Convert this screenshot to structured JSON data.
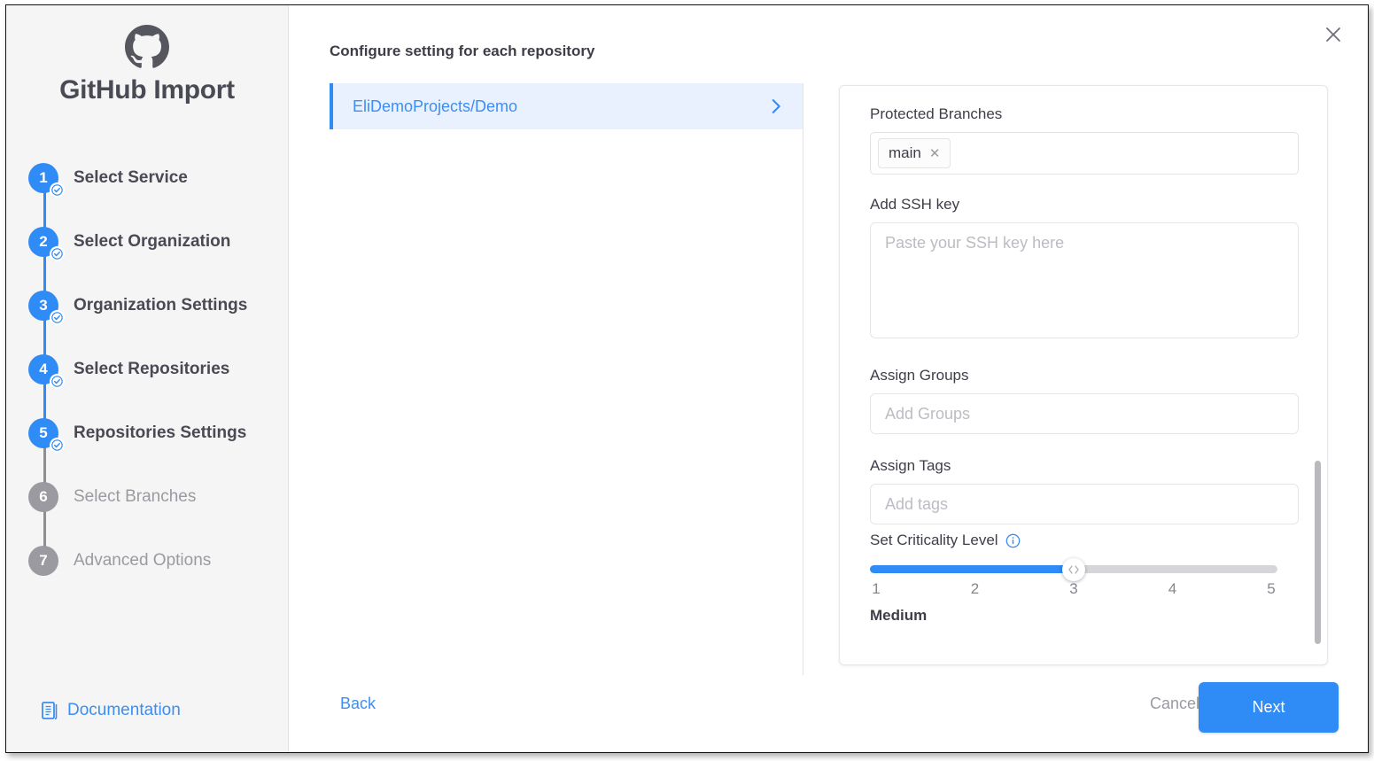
{
  "app": {
    "brand_title": "GitHub Import",
    "logo_icon": "github-icon",
    "close_icon": "close-icon"
  },
  "sidebar": {
    "steps": [
      {
        "number": "1",
        "label": "Select Service",
        "state": "completed"
      },
      {
        "number": "2",
        "label": "Select Organization",
        "state": "completed"
      },
      {
        "number": "3",
        "label": "Organization Settings",
        "state": "completed"
      },
      {
        "number": "4",
        "label": "Select Repositories",
        "state": "completed"
      },
      {
        "number": "5",
        "label": "Repositories Settings",
        "state": "completed"
      },
      {
        "number": "6",
        "label": "Select Branches",
        "state": "pending"
      },
      {
        "number": "7",
        "label": "Advanced Options",
        "state": "pending"
      }
    ],
    "documentation": {
      "label": "Documentation",
      "icon": "document-icon"
    }
  },
  "main": {
    "title": "Configure setting for each repository",
    "repositories": [
      {
        "name": "EliDemoProjects/Demo",
        "selected": true,
        "chevron_icon": "chevron-right-icon"
      }
    ],
    "settings": {
      "protected_branches": {
        "label": "Protected Branches",
        "chips": [
          {
            "text": "main",
            "remove_icon": "close-icon"
          }
        ]
      },
      "ssh_key": {
        "label": "Add SSH key",
        "placeholder": "Paste your SSH key here",
        "value": ""
      },
      "assign_groups": {
        "label": "Assign Groups",
        "placeholder": "Add Groups",
        "value": ""
      },
      "assign_tags": {
        "label": "Assign Tags",
        "placeholder": "Add tags",
        "value": ""
      },
      "criticality": {
        "label": "Set Criticality Level",
        "info_icon": "info-icon",
        "ticks": [
          "1",
          "2",
          "3",
          "4",
          "5"
        ],
        "value": "3",
        "value_label": "Medium"
      }
    }
  },
  "footer": {
    "back_label": "Back",
    "cancel_label": "Cancel",
    "next_label": "Next"
  },
  "colors": {
    "accent": "#2f8bf5",
    "link": "#3b8ef3",
    "sidebar_bg": "#f5f5f5",
    "selected_row_bg": "#e9f1fe",
    "muted_text": "#9a9aa0",
    "heading_text": "#3e3e49"
  }
}
